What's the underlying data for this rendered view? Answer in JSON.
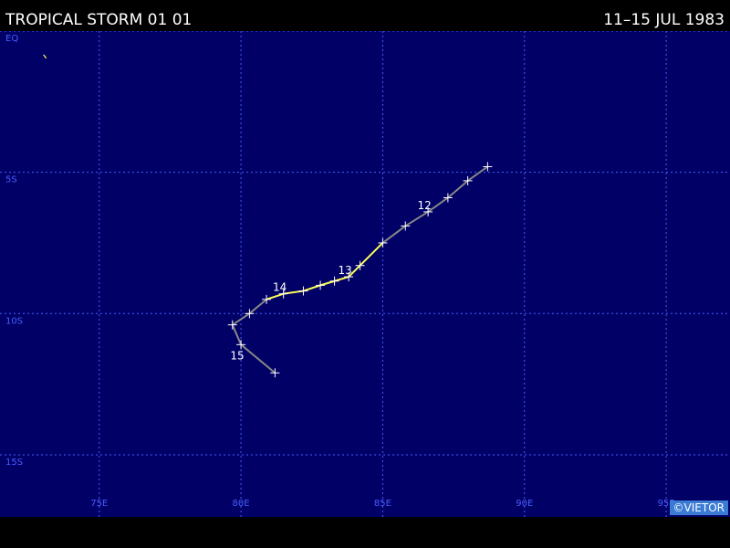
{
  "header": {
    "title": "TROPICAL STORM 01 01",
    "date_range": "11–15 JUL 1983"
  },
  "map": {
    "lat_labels": [
      "EQ",
      "5S",
      "10S",
      "15S"
    ],
    "lon_labels": [
      "75E",
      "80E",
      "85E",
      "90E",
      "95E"
    ],
    "lon_range": [
      71.5,
      97.25
    ],
    "lat_range": [
      0,
      -17.2
    ],
    "colors": {
      "ocean": "#000066",
      "grid": "#4a5cff",
      "track_weak": "#888888",
      "track_storm": "#ffff55",
      "marker": "#ffffff"
    },
    "track": [
      {
        "lon": 88.7,
        "lat": -4.8,
        "type": "weak"
      },
      {
        "lon": 88.0,
        "lat": -5.3,
        "type": "weak"
      },
      {
        "lon": 87.3,
        "lat": -5.9,
        "type": "weak"
      },
      {
        "lon": 86.6,
        "lat": -6.4,
        "type": "weak"
      },
      {
        "lon": 85.8,
        "lat": -6.9,
        "type": "weak"
      },
      {
        "lon": 85.0,
        "lat": -7.5,
        "type": "storm"
      },
      {
        "lon": 84.2,
        "lat": -8.3,
        "type": "storm"
      },
      {
        "lon": 83.8,
        "lat": -8.7,
        "type": "storm"
      },
      {
        "lon": 83.3,
        "lat": -8.85,
        "type": "storm"
      },
      {
        "lon": 82.8,
        "lat": -9.0,
        "type": "storm"
      },
      {
        "lon": 82.2,
        "lat": -9.2,
        "type": "storm"
      },
      {
        "lon": 81.5,
        "lat": -9.3,
        "type": "storm"
      },
      {
        "lon": 80.9,
        "lat": -9.5,
        "type": "weak"
      },
      {
        "lon": 80.3,
        "lat": -10.0,
        "type": "weak"
      },
      {
        "lon": 79.7,
        "lat": -10.4,
        "type": "weak"
      },
      {
        "lon": 80.0,
        "lat": -11.1,
        "type": "weak"
      },
      {
        "lon": 81.2,
        "lat": -12.1,
        "type": "weak"
      }
    ],
    "day_labels": [
      {
        "text": "12",
        "lon": 86.6,
        "lat": -6.4
      },
      {
        "text": "13",
        "lon": 83.8,
        "lat": -8.7
      },
      {
        "text": "14",
        "lon": 81.5,
        "lat": -9.3
      },
      {
        "text": "15",
        "lon": 80.0,
        "lat": -11.1
      }
    ],
    "stray_mark": {
      "lon": 73.1,
      "lat": -0.9
    }
  },
  "footer": {
    "credit": "©VIETOR"
  }
}
